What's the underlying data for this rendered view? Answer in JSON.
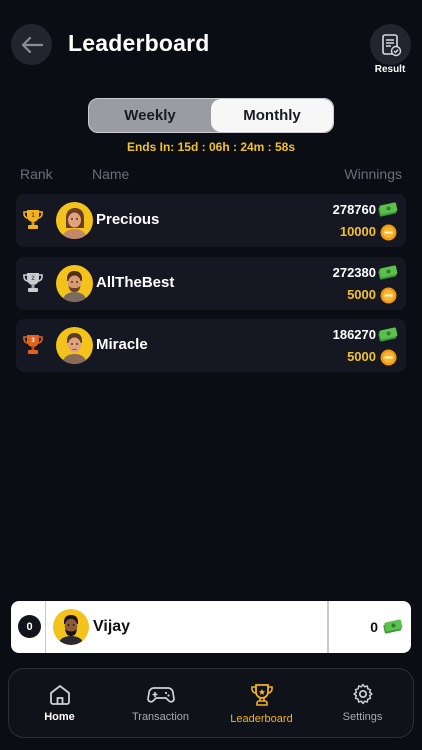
{
  "header": {
    "title": "Leaderboard",
    "result_label": "Result"
  },
  "tabs": [
    {
      "label": "Weekly",
      "active": false
    },
    {
      "label": "Monthly",
      "active": true
    }
  ],
  "countdown": "Ends In: 15d : 06h : 24m : 58s",
  "columns": {
    "rank": "Rank",
    "name": "Name",
    "winnings": "Winnings"
  },
  "players": [
    {
      "rank": "1",
      "name": "Precious",
      "points": "278760",
      "coins": "10000",
      "trophy": "gold-trophy-icon"
    },
    {
      "rank": "2",
      "name": "AllTheBest",
      "points": "272380",
      "coins": "5000",
      "trophy": "silver-trophy-icon"
    },
    {
      "rank": "3",
      "name": "Miracle",
      "points": "186270",
      "coins": "5000",
      "trophy": "bronze-trophy-icon"
    }
  ],
  "me": {
    "rank": "0",
    "name": "Vijay",
    "winnings": "0"
  },
  "nav": [
    {
      "label": "Home",
      "icon": "home-icon"
    },
    {
      "label": "Transaction",
      "icon": "gamepad-icon"
    },
    {
      "label": "Leaderboard",
      "icon": "trophy-icon"
    },
    {
      "label": "Settings",
      "icon": "gear-icon"
    }
  ],
  "colors": {
    "background": "#0b0d14",
    "accent": "#f2c12e",
    "card": "#151822"
  }
}
